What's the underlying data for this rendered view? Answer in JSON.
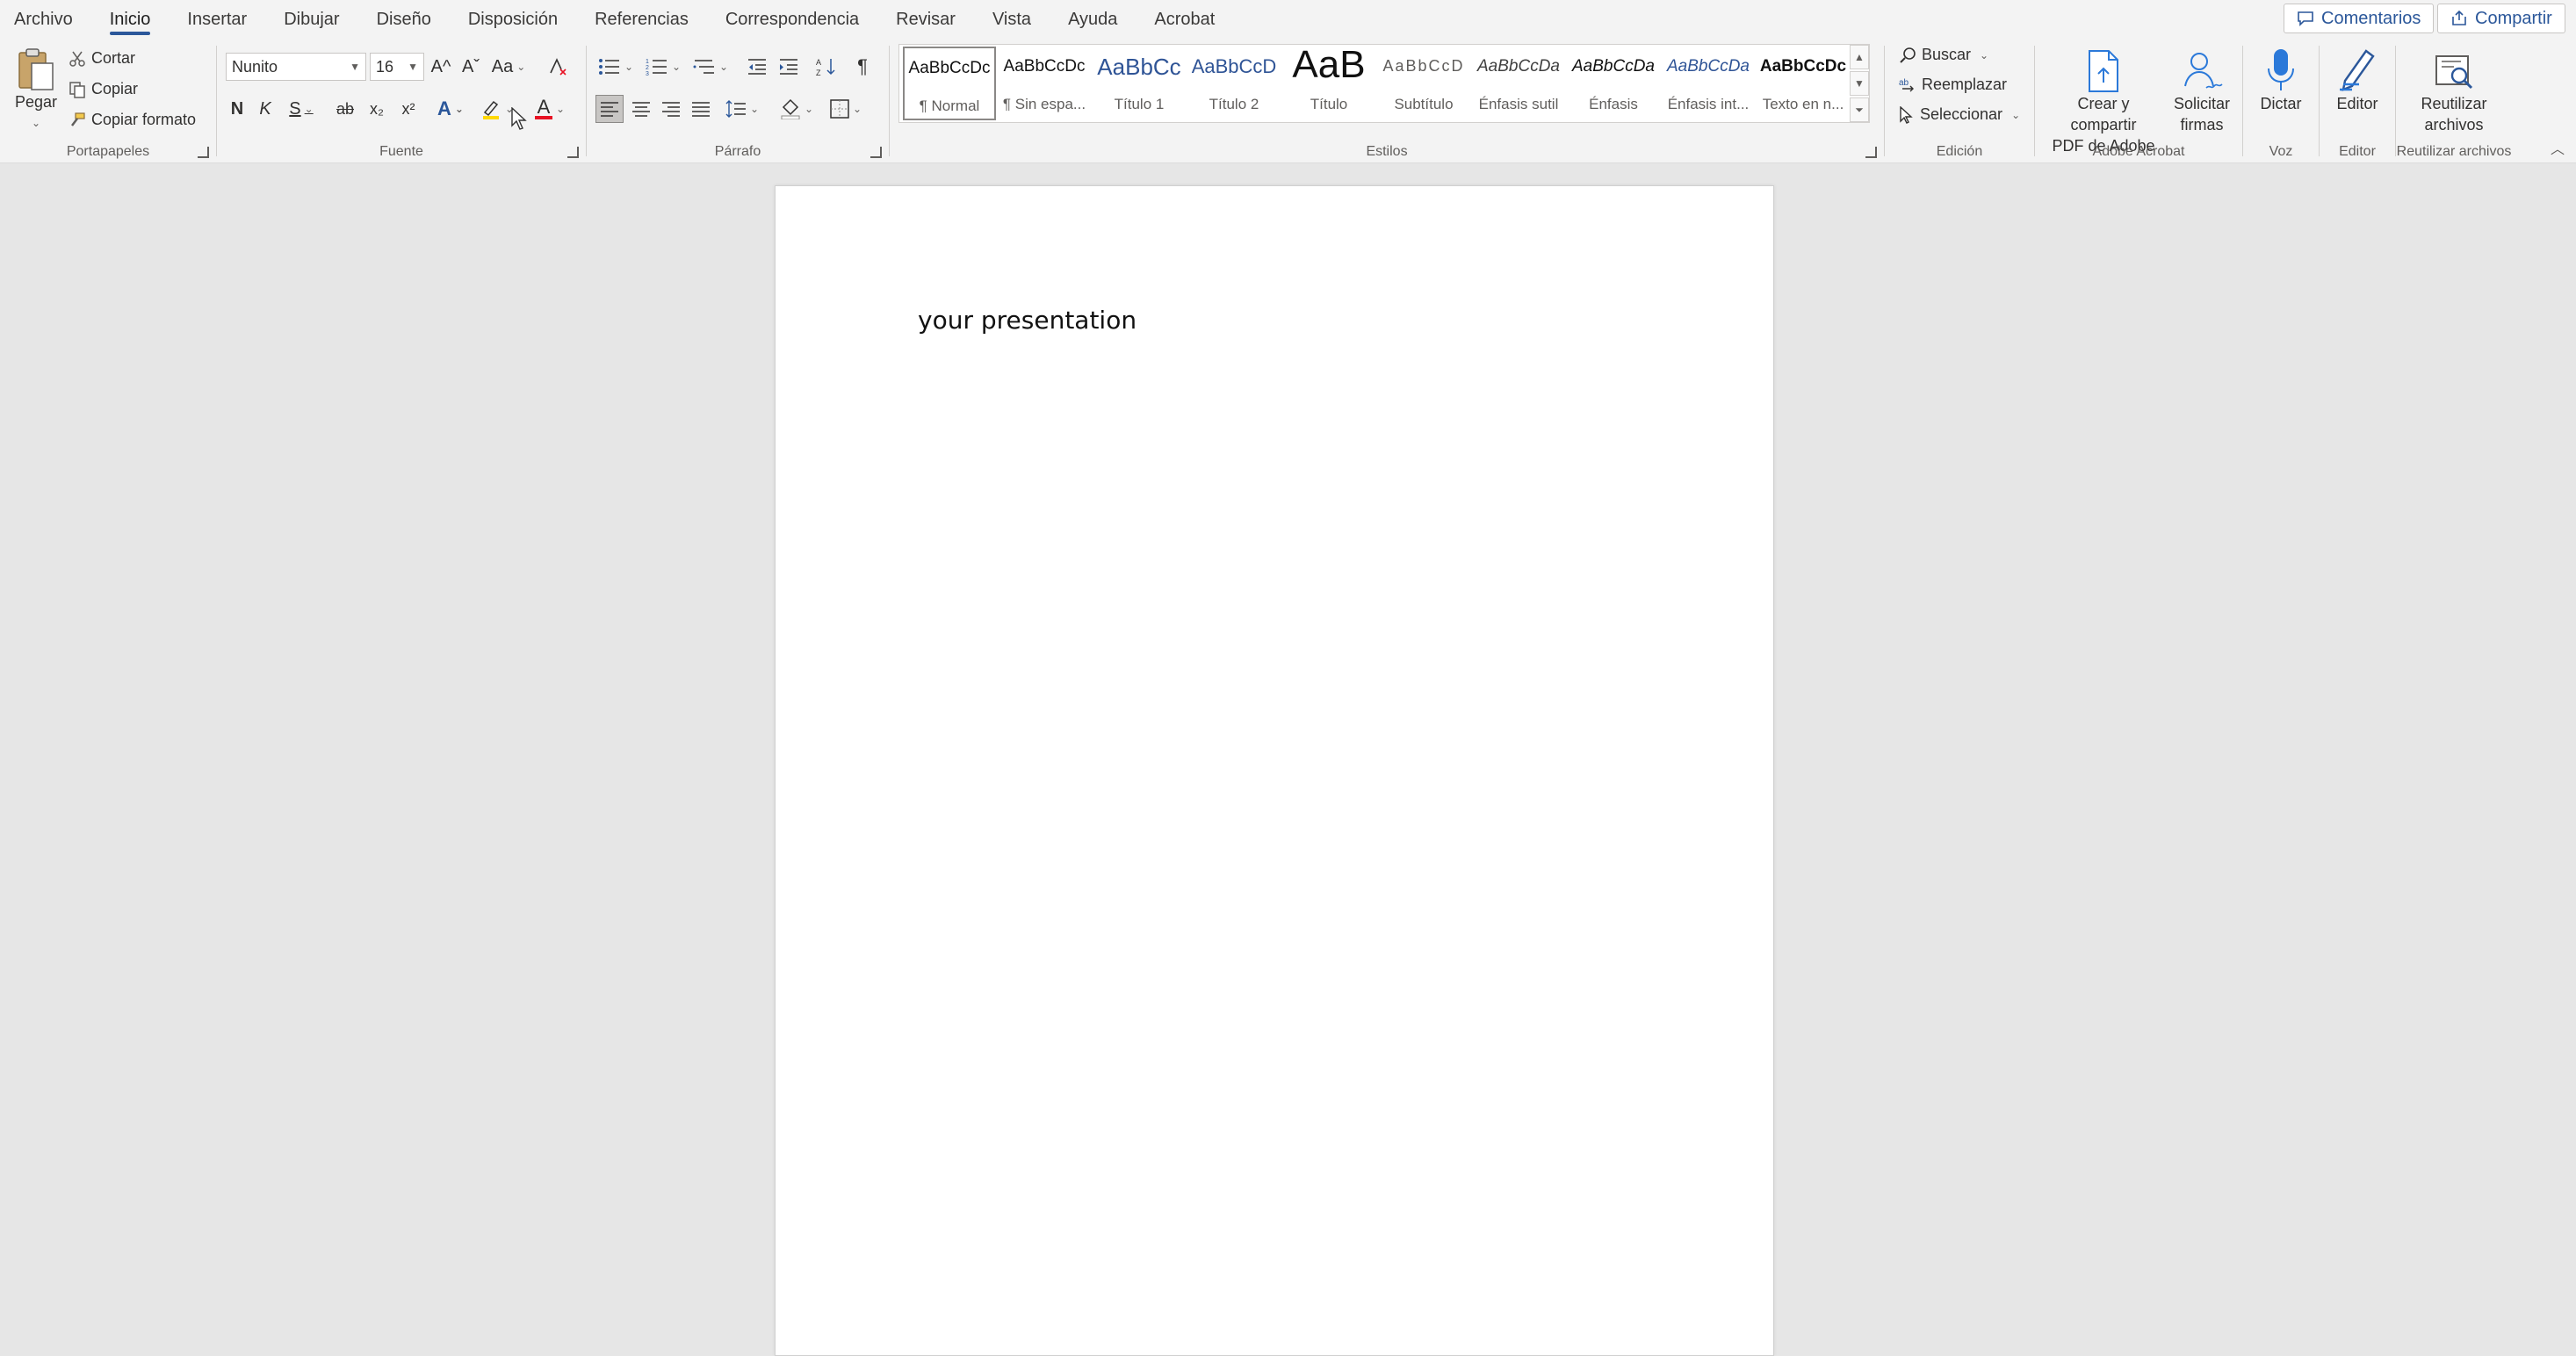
{
  "menu": {
    "tabs": [
      {
        "label": "Archivo"
      },
      {
        "label": "Inicio"
      },
      {
        "label": "Insertar"
      },
      {
        "label": "Dibujar"
      },
      {
        "label": "Diseño"
      },
      {
        "label": "Disposición"
      },
      {
        "label": "Referencias"
      },
      {
        "label": "Correspondencia"
      },
      {
        "label": "Revisar"
      },
      {
        "label": "Vista"
      },
      {
        "label": "Ayuda"
      },
      {
        "label": "Acrobat"
      }
    ],
    "active_tab": "Inicio",
    "comments_label": "Comentarios",
    "share_label": "Compartir"
  },
  "clipboard": {
    "paste_label": "Pegar",
    "cut_label": "Cortar",
    "copy_label": "Copiar",
    "format_painter_label": "Copiar formato",
    "group_label": "Portapapeles"
  },
  "font": {
    "font_name": "Nunito",
    "font_size": "16",
    "group_label": "Fuente",
    "bold_label": "N",
    "italic_label": "K",
    "underline_label": "S",
    "strike_label": "ab",
    "subscript_label": "x₂",
    "superscript_label": "x²",
    "change_case_label": "Aa",
    "grow_label": "A^",
    "shrink_label": "Aˇ",
    "text_effects_label": "A",
    "font_color_label": "A"
  },
  "paragraph": {
    "group_label": "Párrafo"
  },
  "styles": {
    "group_label": "Estilos",
    "items": [
      {
        "sample": "AaBbCcDc",
        "name": "¶ Normal"
      },
      {
        "sample": "AaBbCcDc",
        "name": "¶ Sin espa..."
      },
      {
        "sample": "AaBbCc",
        "name": "Título 1"
      },
      {
        "sample": "AaBbCcD",
        "name": "Título 2"
      },
      {
        "sample": "AaB",
        "name": "Título"
      },
      {
        "sample": "AaBbCcD",
        "name": "Subtítulo"
      },
      {
        "sample": "AaBbCcDa",
        "name": "Énfasis sutil"
      },
      {
        "sample": "AaBbCcDa",
        "name": "Énfasis"
      },
      {
        "sample": "AaBbCcDa",
        "name": "Énfasis int..."
      },
      {
        "sample": "AaBbCcDc",
        "name": "Texto en n..."
      }
    ]
  },
  "editing": {
    "find_label": "Buscar",
    "replace_label": "Reemplazar",
    "select_label": "Seleccionar",
    "group_label": "Edición"
  },
  "acrobat": {
    "create_label_1": "Crear y compartir",
    "create_label_2": "PDF de Adobe",
    "sign_label_1": "Solicitar",
    "sign_label_2": "firmas",
    "group_label": "Adobe Acrobat"
  },
  "voice": {
    "dictate_label": "Dictar",
    "group_label": "Voz"
  },
  "editor": {
    "editor_label": "Editor",
    "group_label": "Editor"
  },
  "reuse": {
    "reuse_label_1": "Reutilizar",
    "reuse_label_2": "archivos",
    "group_label": "Reutilizar archivos"
  },
  "document": {
    "text": "your presentation"
  },
  "colors": {
    "accent": "#2b579a",
    "highlight": "#ffd800",
    "font_color": "#e81123",
    "style_heading": "#2f5496"
  }
}
